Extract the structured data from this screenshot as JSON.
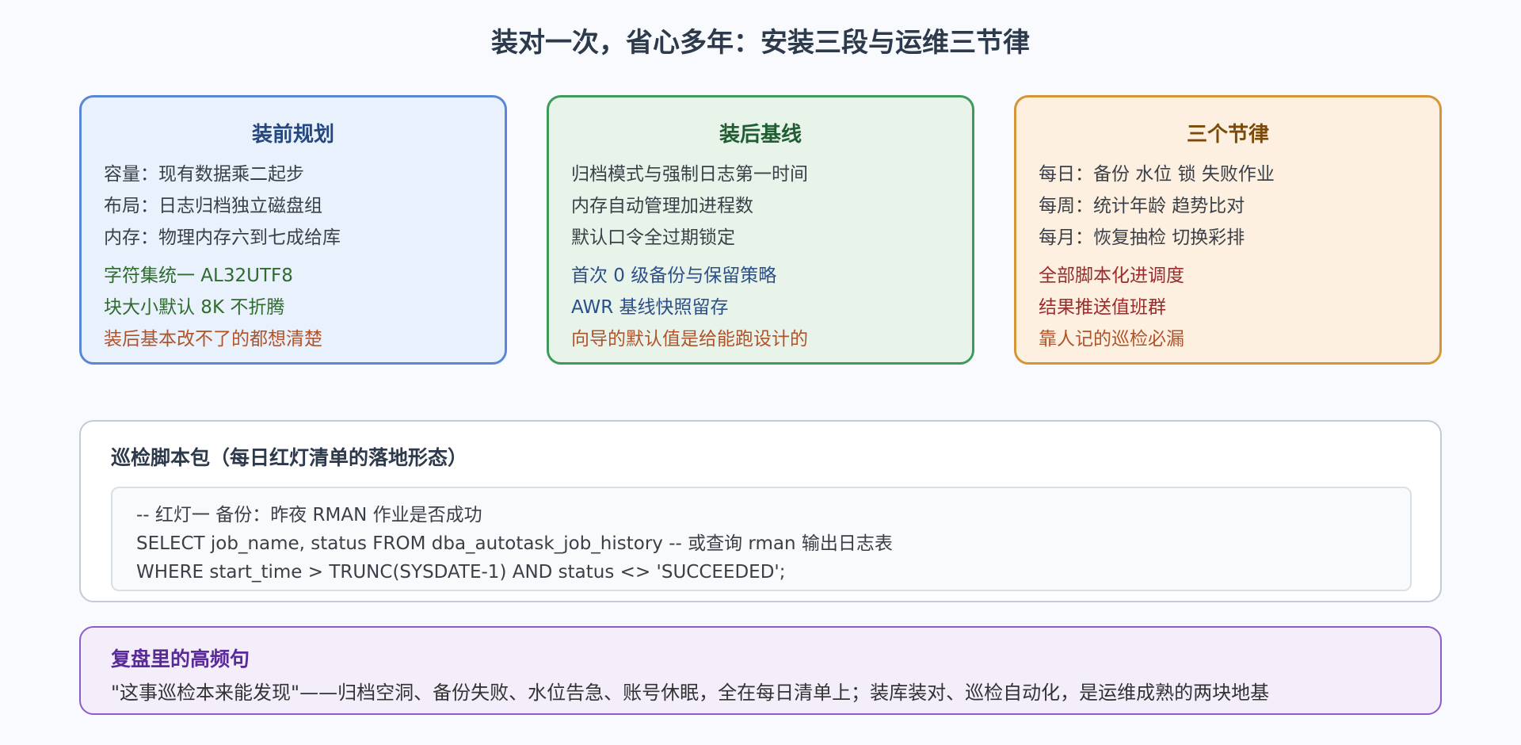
{
  "title": "装对一次，省心多年：安装三段与运维三节律",
  "cards": [
    {
      "heading": "装前规划",
      "lines": [
        "容量：现有数据乘二起步",
        "布局：日志归档独立磁盘组",
        "内存：物理内存六到七成给库",
        "字符集统一 AL32UTF8",
        "块大小默认 8K 不折腾",
        "装后基本改不了的都想清楚"
      ]
    },
    {
      "heading": "装后基线",
      "lines": [
        "归档模式与强制日志第一时间",
        "内存自动管理加进程数",
        "默认口令全过期锁定",
        "首次 0 级备份与保留策略",
        "AWR 基线快照留存",
        "向导的默认值是给能跑设计的"
      ]
    },
    {
      "heading": "三个节律",
      "lines": [
        "每日：备份 水位 锁 失败作业",
        "每周：统计年龄 趋势比对",
        "每月：恢复抽检 切换彩排",
        "全部脚本化进调度",
        "结果推送值班群",
        "靠人记的巡检必漏"
      ]
    }
  ],
  "script_pack": {
    "title": "巡检脚本包（每日红灯清单的落地形态）",
    "code_lines": [
      "-- 红灯一 备份：昨夜 RMAN 作业是否成功",
      "SELECT job_name, status FROM dba_autotask_job_history -- 或查询 rman 输出日志表",
      "WHERE start_time > TRUNC(SYSDATE-1) AND status <> 'SUCCEEDED';"
    ]
  },
  "quote": {
    "title": "复盘里的高频句",
    "text": "\"这事巡检本来能发现\"——归档空洞、备份失败、水位告急、账号休眠，全在每日清单上；装库装对、巡检自动化，是运维成熟的两块地基"
  }
}
